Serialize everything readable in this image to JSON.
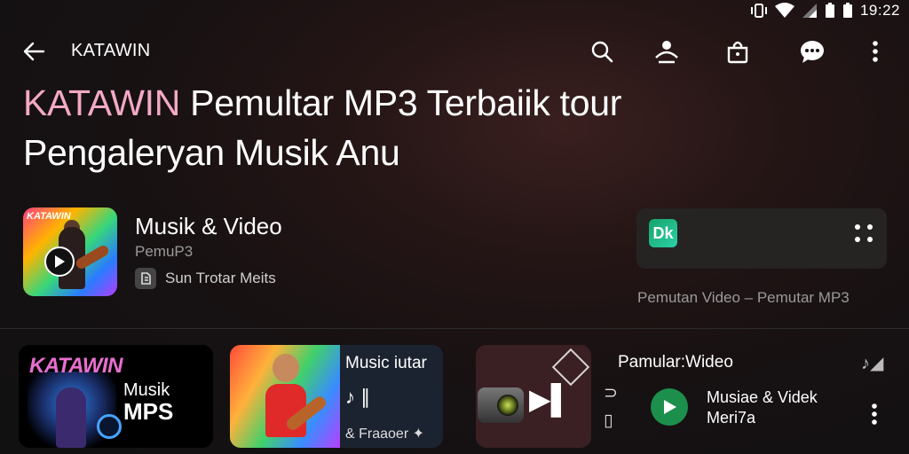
{
  "status_bar": {
    "time": "19:22"
  },
  "app_bar": {
    "title": "KATAWIN",
    "icons": [
      "back-arrow-icon",
      "search-icon",
      "user-icon",
      "bag-icon",
      "chat-icon",
      "more-vert-icon"
    ]
  },
  "headline": {
    "brand": "KATAWIN",
    "line1_rest": "Pemultar MP3 Terbaiik tour",
    "line2": "Pengaleryan Musik Anu"
  },
  "app_card": {
    "name": "Musik & Video",
    "subtitle": "PemuP3",
    "developer": "Sun Trotar Meits",
    "icon_label": "KATAWIN"
  },
  "mini_player": {
    "logo_text": "Dk",
    "caption": "Pemutan Video – Pemutar MP3"
  },
  "tiles": {
    "tile1": {
      "logo": "KATAWIN",
      "label_line1": "Musik",
      "label_line2": "MPS"
    },
    "tile2": {
      "title": "Music iutar",
      "icons_text": "♪ ∥",
      "caption": "& Fraaoer ✦"
    },
    "tile3": {
      "play_glyph": "▶▌"
    }
  },
  "right_item": {
    "title": "Pamular:Wideo",
    "app_name_line1": "Musiae & Videk",
    "app_name_line2": "Meri7a"
  },
  "colors": {
    "brand_pink": "#f3a9c6",
    "background": "#171112",
    "surface": "#262323",
    "muted_text": "#9a9a9a"
  }
}
